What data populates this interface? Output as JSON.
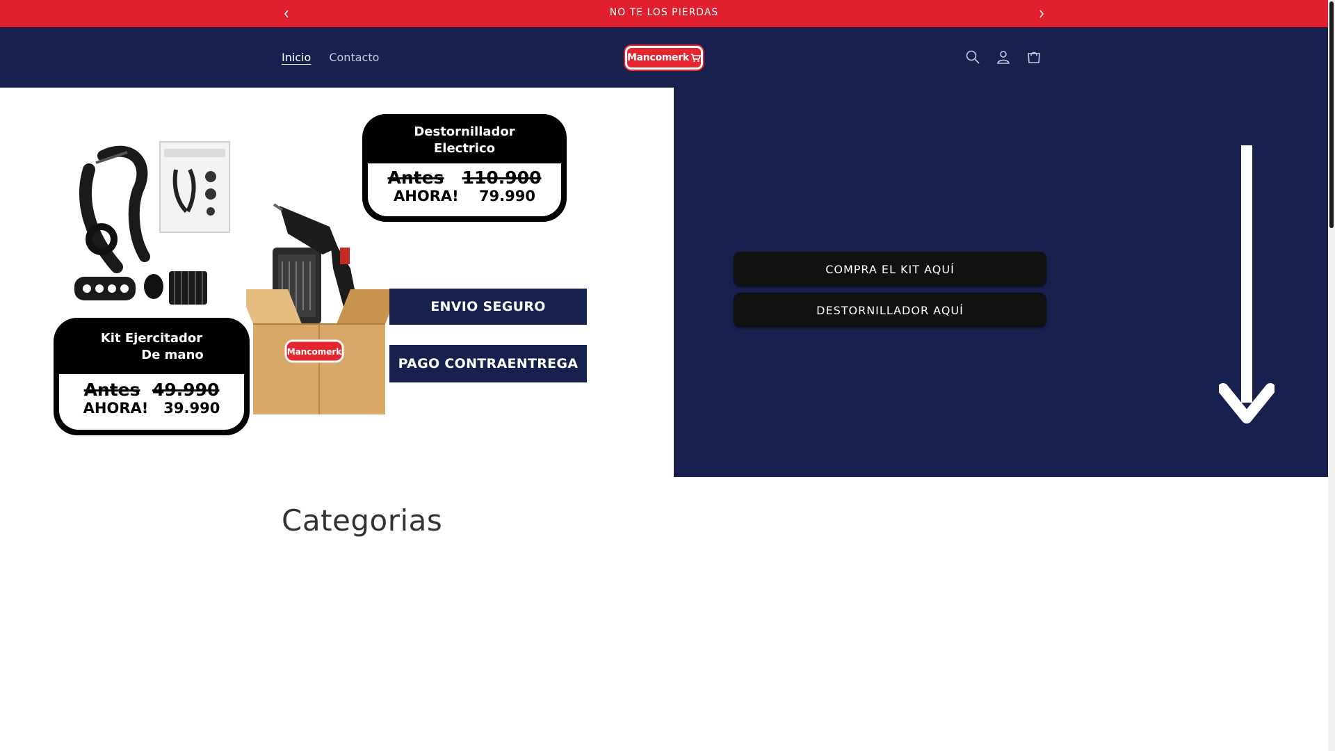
{
  "announcement": {
    "message": "NO TE LOS PIERDAS",
    "prev_icon": "chevron-left-icon",
    "next_icon": "chevron-right-icon"
  },
  "header": {
    "nav": [
      {
        "label": "Inicio",
        "active": true
      },
      {
        "label": "Contacto",
        "active": false
      }
    ],
    "logo_text": "Mancomerk",
    "icons": [
      "search-icon",
      "account-icon",
      "cart-icon"
    ]
  },
  "hero": {
    "promo": {
      "product_1_title_line1": "Destornillador",
      "product_1_title_line2": "Electrico",
      "product_1_before_label": "Antes",
      "product_1_before_price": "110.900",
      "product_1_now_label": "AHORA!",
      "product_1_now_price": "79.990",
      "banner_shipping": "ENVIO SEGURO",
      "banner_payment": "PAGO CONTRAENTREGA",
      "product_2_title_line1": "Kit Ejercitador",
      "product_2_title_line2": "De mano",
      "product_2_before_label": "Antes",
      "product_2_before_price": "49.990",
      "product_2_now_label": "AHORA!",
      "product_2_now_price": "39.990",
      "box_logo_text": "Mancomerk"
    },
    "buttons": [
      {
        "label": "COMPRA EL KIT AQUÍ"
      },
      {
        "label": "DESTORNILLADOR AQUÍ"
      }
    ],
    "arrow_icon": "arrow-down-icon"
  },
  "sections": {
    "categories_title": "Categorias"
  },
  "colors": {
    "announcement_bg": "#df1f2d",
    "header_bg": "#18214e",
    "button_bg": "#111111"
  }
}
